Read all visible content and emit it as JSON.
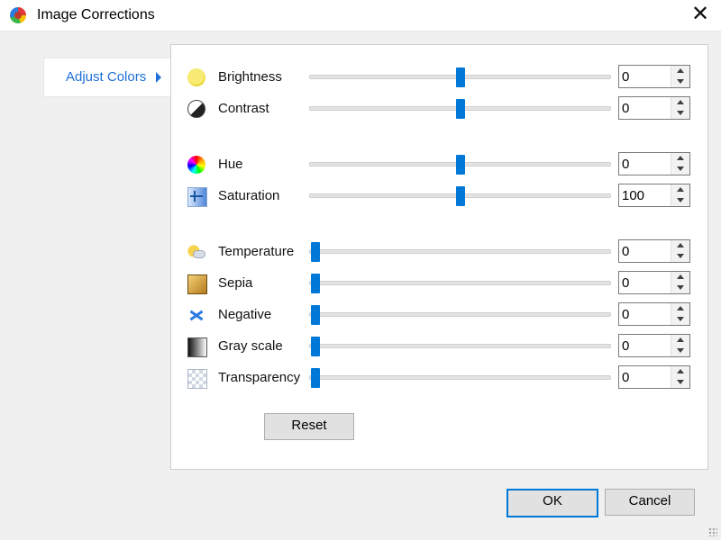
{
  "window": {
    "title": "Image Corrections",
    "close_symbol": "✕",
    "icon": "app-icon"
  },
  "nav": {
    "selected": "Adjust Colors",
    "arrow_icon": "chevron-right-icon"
  },
  "sliders": [
    {
      "key": "brightness",
      "label": "Brightness",
      "icon": "sun-icon",
      "value": "0",
      "level": 0.5
    },
    {
      "key": "contrast",
      "label": "Contrast",
      "icon": "contrast-icon",
      "value": "0",
      "level": 0.5
    },
    {
      "key": "hue",
      "label": "Hue",
      "icon": "hue-icon",
      "value": "0",
      "level": 0.5
    },
    {
      "key": "saturation",
      "label": "Saturation",
      "icon": "saturation-icon",
      "value": "100",
      "level": 0.5
    },
    {
      "key": "temperature",
      "label": "Temperature",
      "icon": "weather-icon",
      "value": "0",
      "level": 0.0
    },
    {
      "key": "sepia",
      "label": "Sepia",
      "icon": "sepia-image-icon",
      "value": "0",
      "level": 0.0
    },
    {
      "key": "negative",
      "label": "Negative",
      "icon": "negative-icon",
      "value": "0",
      "level": 0.0
    },
    {
      "key": "grayscale",
      "label": "Gray scale",
      "icon": "grayscale-icon",
      "value": "0",
      "level": 0.0
    },
    {
      "key": "transparency",
      "label": "Transparency",
      "icon": "transparency-icon",
      "value": "0",
      "level": 0.0
    }
  ],
  "buttons": {
    "reset": "Reset",
    "ok": "OK",
    "cancel": "Cancel"
  },
  "colors": {
    "accent": "#0078d7",
    "link": "#1e6fd9"
  }
}
